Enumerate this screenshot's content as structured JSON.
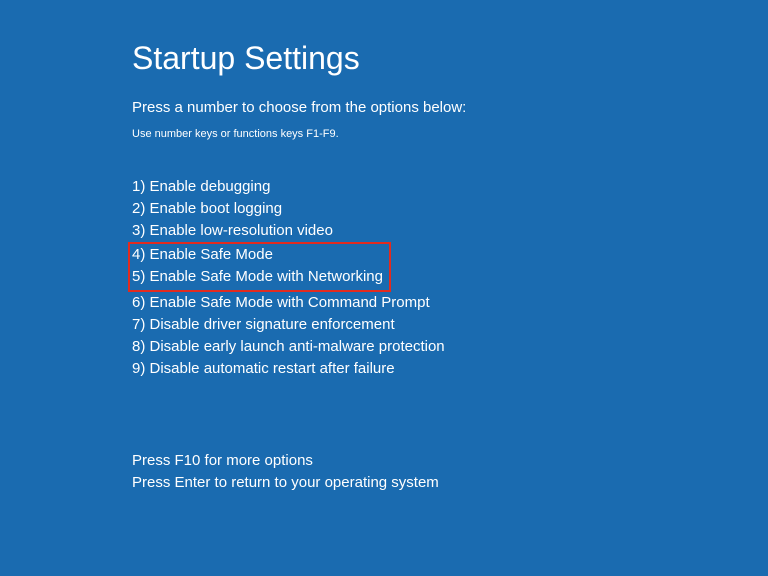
{
  "title": "Startup Settings",
  "subtitle": "Press a number to choose from the options below:",
  "hint": "Use number keys or functions keys F1-F9.",
  "options": [
    "1) Enable debugging",
    "2) Enable boot logging",
    "3) Enable low-resolution video",
    "4) Enable Safe Mode",
    "5) Enable Safe Mode with Networking",
    "6) Enable Safe Mode with Command Prompt",
    "7) Disable driver signature enforcement",
    "8) Disable early launch anti-malware protection",
    "9) Disable automatic restart after failure"
  ],
  "footer": [
    "Press F10 for more options",
    "Press Enter to return to your operating system"
  ]
}
